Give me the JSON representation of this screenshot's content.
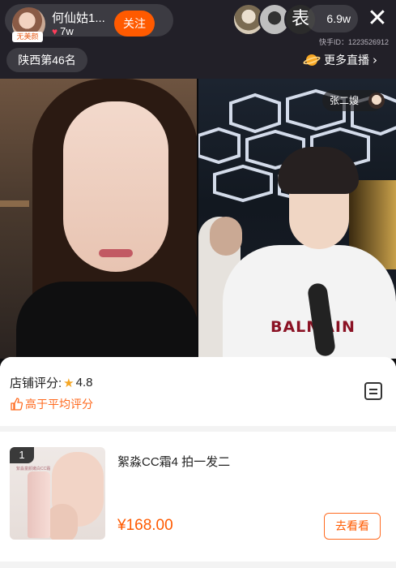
{
  "header": {
    "host_name": "何仙姑1...",
    "host_badge": "无美颜",
    "host_likes": "7w",
    "follow_label": "关注",
    "viewer_avatar_3_text": "表",
    "viewer_count": "6.9w",
    "close_label": "✕",
    "kuaishou_id": "快手ID：1223526912",
    "rank_text": "陕西第46名",
    "more_live_label": "更多直播",
    "more_live_chevron": "›"
  },
  "video": {
    "guest_name": "张二嫂",
    "shirt_text": "BALMAIN"
  },
  "shop": {
    "rating_label": "店铺评分:",
    "rating_value": "4.8",
    "above_average_label": "高于平均评分"
  },
  "product": {
    "index": "1",
    "image_text": "絮淼童颜嫩白CC霜",
    "title": "絮淼CC霜4 拍一发二",
    "price": "¥168.00",
    "goto_label": "去看看"
  },
  "colors": {
    "accent": "#ff5a00",
    "star": "#f5a623",
    "header_bg": "#222028"
  },
  "icons": [
    "heart-icon",
    "close-icon",
    "planet-icon",
    "chevron-right-icon",
    "star-icon",
    "thumb-up-icon",
    "list-icon"
  ]
}
